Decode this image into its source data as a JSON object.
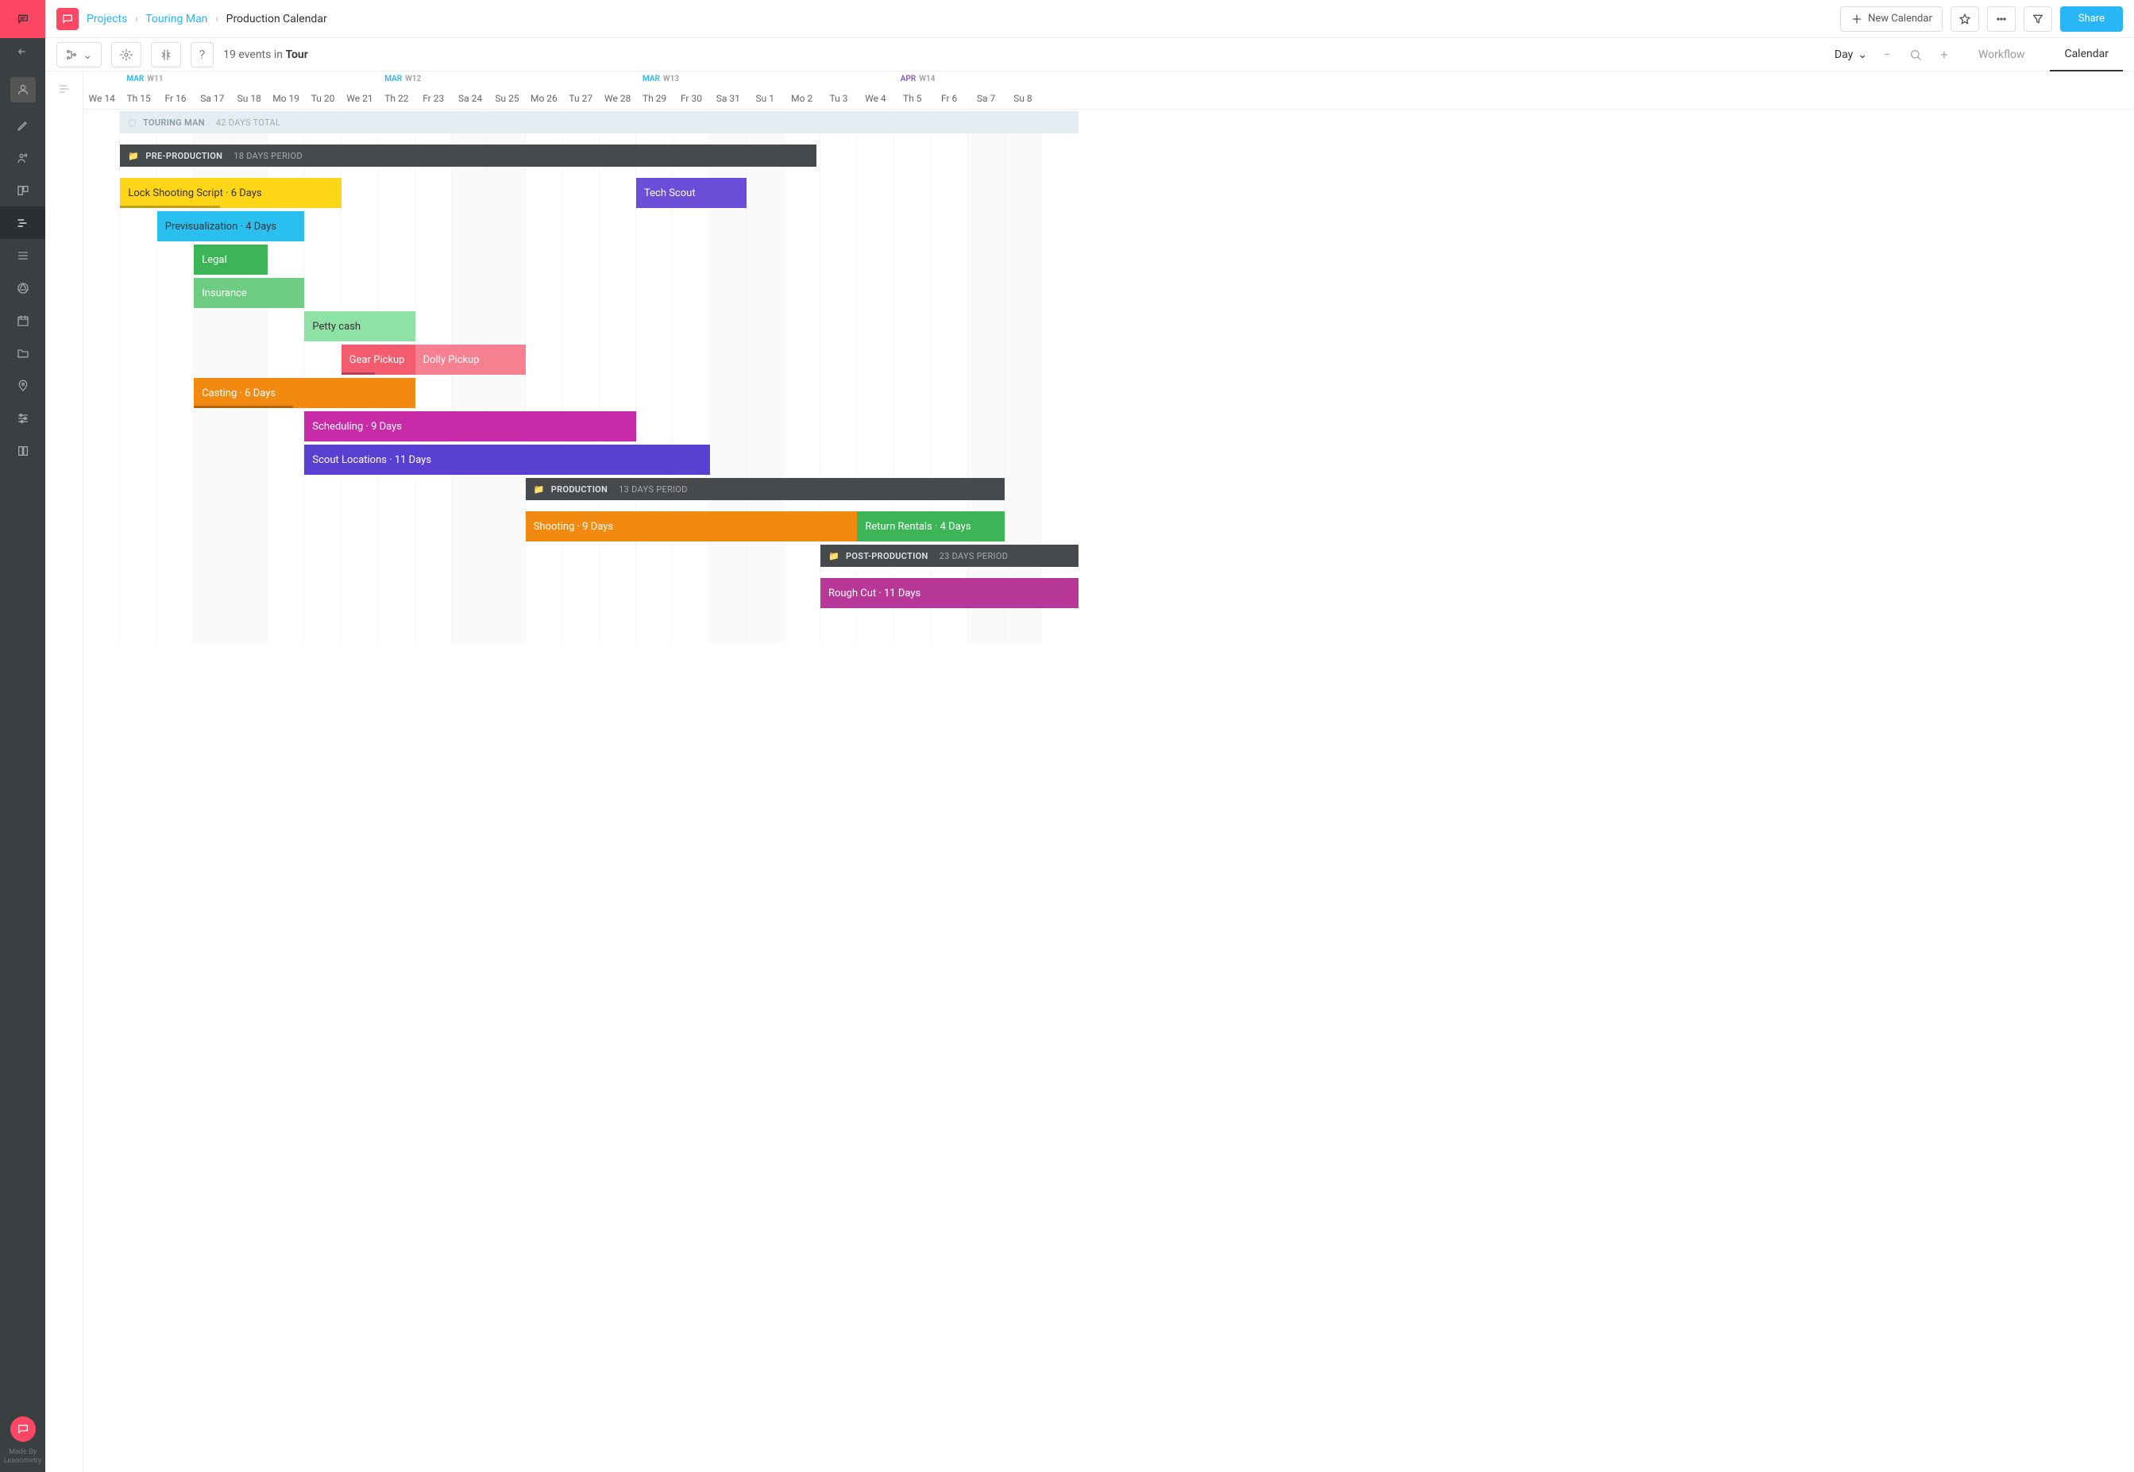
{
  "breadcrumb": {
    "projects": "Projects",
    "project": "Touring Man",
    "page": "Production Calendar"
  },
  "topbar": {
    "new_calendar": "New Calendar",
    "share": "Share"
  },
  "toolbar": {
    "events_count": "19",
    "events_in": "events in",
    "scope": "Tour",
    "day": "Day"
  },
  "tabs": {
    "workflow": "Workflow",
    "calendar": "Calendar"
  },
  "footer": {
    "made": "Made By",
    "brand": "Leanometry"
  },
  "timeline": {
    "col_width": 46.4,
    "weeks": [
      {
        "month": "MAR",
        "week": "W11",
        "at": 1,
        "cls": ""
      },
      {
        "month": "MAR",
        "week": "W12",
        "at": 8,
        "cls": ""
      },
      {
        "month": "MAR",
        "week": "W13",
        "at": 15,
        "cls": ""
      },
      {
        "month": "APR",
        "week": "W14",
        "at": 22,
        "cls": "apr"
      }
    ],
    "days": [
      {
        "lbl": "We 14",
        "we": false
      },
      {
        "lbl": "Th 15",
        "we": false
      },
      {
        "lbl": "Fr 16",
        "we": false
      },
      {
        "lbl": "Sa 17",
        "we": true
      },
      {
        "lbl": "Su 18",
        "we": true
      },
      {
        "lbl": "Mo 19",
        "we": false
      },
      {
        "lbl": "Tu 20",
        "we": false
      },
      {
        "lbl": "We 21",
        "we": false
      },
      {
        "lbl": "Th 22",
        "we": false
      },
      {
        "lbl": "Fr 23",
        "we": false
      },
      {
        "lbl": "Sa 24",
        "we": true
      },
      {
        "lbl": "Su 25",
        "we": true
      },
      {
        "lbl": "Mo 26",
        "we": false
      },
      {
        "lbl": "Tu 27",
        "we": false
      },
      {
        "lbl": "We 28",
        "we": false
      },
      {
        "lbl": "Th 29",
        "we": false
      },
      {
        "lbl": "Fr 30",
        "we": false
      },
      {
        "lbl": "Sa 31",
        "we": true
      },
      {
        "lbl": "Su 1",
        "we": true
      },
      {
        "lbl": "Mo 2",
        "we": false
      },
      {
        "lbl": "Tu 3",
        "we": false
      },
      {
        "lbl": "We 4",
        "we": false
      },
      {
        "lbl": "Th 5",
        "we": false
      },
      {
        "lbl": "Fr 6",
        "we": false
      },
      {
        "lbl": "Sa 7",
        "we": true
      },
      {
        "lbl": "Su 8",
        "we": true
      }
    ]
  },
  "summary": {
    "title": "TOURING MAN",
    "meta": "42 DAYS TOTAL",
    "start": 1,
    "span": 26
  },
  "phases": [
    {
      "id": "pre",
      "title": "PRE-PRODUCTION",
      "meta": "18 DAYS PERIOD",
      "start": 1,
      "span": 18.9,
      "row": 1
    },
    {
      "id": "prod",
      "title": "PRODUCTION",
      "meta": "13 DAYS PERIOD",
      "start": 12,
      "span": 13,
      "row": 11
    },
    {
      "id": "post",
      "title": "POST-PRODUCTION",
      "meta": "23 DAYS PERIOD",
      "start": 20,
      "span": 7,
      "row": 13
    }
  ],
  "events": [
    {
      "label": "Lock Shooting Script · 6 Days",
      "start": 1,
      "span": 6,
      "row": 2,
      "color": "#ffd617",
      "dark": true,
      "stripe": true
    },
    {
      "label": "Tech Scout",
      "start": 15,
      "span": 3,
      "row": 2,
      "color": "#6c4fd8"
    },
    {
      "label": "Previsualization · 4 Days",
      "start": 2,
      "span": 4,
      "row": 3,
      "color": "#29c0f0",
      "dark": true
    },
    {
      "label": "Legal",
      "start": 3,
      "span": 2,
      "row": 4,
      "color": "#3cb557"
    },
    {
      "label": "Insurance",
      "start": 3,
      "span": 3,
      "row": 5,
      "color": "#6fcc83"
    },
    {
      "label": "Petty cash",
      "start": 6,
      "span": 3,
      "row": 6,
      "color": "#8fe2a5",
      "dark": true
    },
    {
      "label": "Gear Pickup",
      "start": 7,
      "span": 2,
      "row": 7,
      "color": "#f25c6e",
      "stripe": true
    },
    {
      "label": "Dolly Pickup",
      "start": 9,
      "span": 3,
      "row": 7,
      "color": "#f58090"
    },
    {
      "label": "Casting · 6 Days",
      "start": 3,
      "span": 6,
      "row": 8,
      "color": "#f28a12",
      "stripe": true
    },
    {
      "label": "Scheduling · 9 Days",
      "start": 6,
      "span": 9,
      "row": 9,
      "color": "#c82aa8"
    },
    {
      "label": "Scout Locations · 11 Days",
      "start": 6,
      "span": 11,
      "row": 10,
      "color": "#5a3fd3"
    },
    {
      "label": "Shooting · 9 Days",
      "start": 12,
      "span": 9,
      "row": 12,
      "color": "#f28a12"
    },
    {
      "label": "Return Rentals · 4 Days",
      "start": 21,
      "span": 4,
      "row": 12,
      "color": "#3cb557"
    },
    {
      "label": "Rough Cut · 11 Days",
      "start": 20,
      "span": 7,
      "row": 14,
      "color": "#b83898"
    }
  ]
}
